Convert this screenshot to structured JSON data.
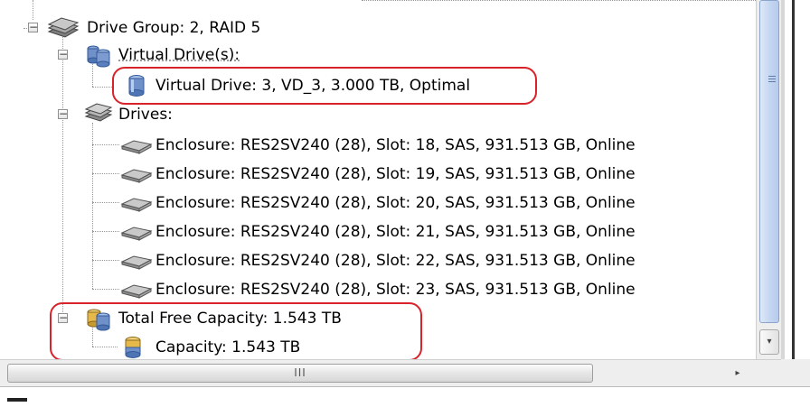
{
  "tree": {
    "drive_group": "Drive Group: 2, RAID  5",
    "virtual_drives_folder": "Virtual Drive(s):",
    "virtual_drive": "Virtual Drive: 3, VD_3, 3.000 TB, Optimal",
    "drives_folder": "Drives:",
    "drives": [
      "Enclosure: RES2SV240 (28), Slot: 18, SAS, 931.513 GB, Online",
      "Enclosure: RES2SV240 (28), Slot: 19, SAS, 931.513 GB, Online",
      "Enclosure: RES2SV240 (28), Slot: 20, SAS, 931.513 GB, Online",
      "Enclosure: RES2SV240 (28), Slot: 21, SAS, 931.513 GB, Online",
      "Enclosure: RES2SV240 (28), Slot: 22, SAS, 931.513 GB, Online",
      "Enclosure: RES2SV240 (28), Slot: 23, SAS, 931.513 GB, Online"
    ],
    "total_free_capacity": "Total Free Capacity: 1.543 TB",
    "capacity": "Capacity: 1.543 TB",
    "expander_collapse_glyph": "−"
  },
  "scrollbar": {
    "horizontal_thumb_grip": "III",
    "right_arrow": "▸",
    "down_arrow": "▾"
  },
  "colors": {
    "highlight": "#d8232a",
    "tree_line": "#9a9a9a",
    "scroll_thumb": "#c5d7f1"
  },
  "icons": {
    "drive_group": "server-stack-icon",
    "virtual_drive_folder": "virtual-drives-icon",
    "virtual_drive": "virtual-drive-cylinder-icon",
    "drives_folder": "drives-stack-icon",
    "drive": "hard-disk-icon",
    "free_capacity_folder": "free-capacity-icon",
    "capacity": "capacity-cylinder-icon"
  }
}
